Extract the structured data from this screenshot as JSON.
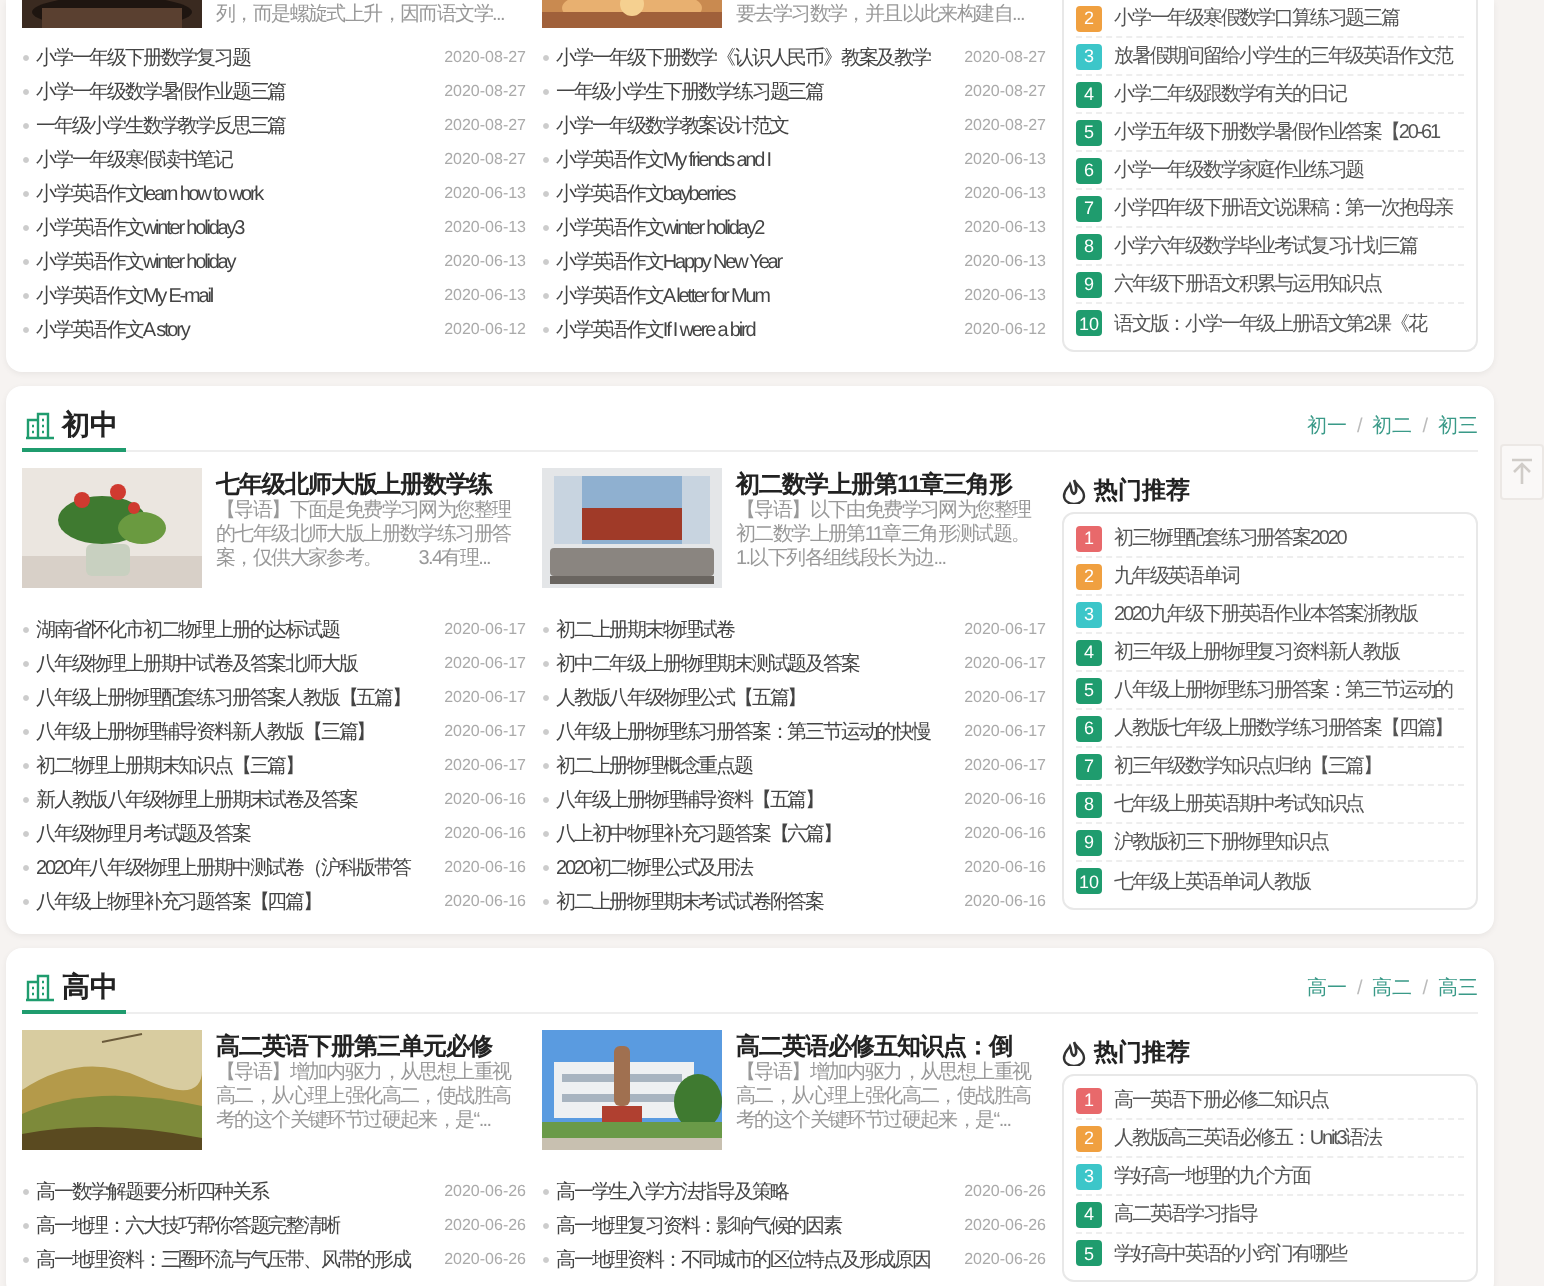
{
  "sections": [
    {
      "kind": "cut_top",
      "features": [
        {
          "snippet": "列，而是螺旋式上升，因而语文学..."
        },
        {
          "snippet": "要去学习数学，并且以此来构建自..."
        }
      ],
      "columns": [
        {
          "items": [
            {
              "title": "小学一年级下册数学复习题",
              "date": "2020-08-27"
            },
            {
              "title": "小学一年级数学暑假作业题三篇",
              "date": "2020-08-27"
            },
            {
              "title": "一年级小学生数学教学反思三篇",
              "date": "2020-08-27"
            },
            {
              "title": "小学一年级寒假读书笔记",
              "date": "2020-08-27"
            },
            {
              "title": "小学英语作文learn how to work",
              "date": "2020-06-13"
            },
            {
              "title": "小学英语作文winter holiday3",
              "date": "2020-06-13"
            },
            {
              "title": "小学英语作文winter holiday",
              "date": "2020-06-13"
            },
            {
              "title": "小学英语作文My E-mail",
              "date": "2020-06-13"
            },
            {
              "title": "小学英语作文A story",
              "date": "2020-06-12"
            }
          ]
        },
        {
          "items": [
            {
              "title": "小学一年级下册数学《认识人民币》教案及教学",
              "date": "2020-08-27"
            },
            {
              "title": "一年级小学生下册数学练习题三篇",
              "date": "2020-08-27"
            },
            {
              "title": "小学一年级数学教案设计范文",
              "date": "2020-08-27"
            },
            {
              "title": "小学英语作文My friends and I",
              "date": "2020-06-13"
            },
            {
              "title": "小学英语作文bayberries",
              "date": "2020-06-13"
            },
            {
              "title": "小学英语作文winter holiday2",
              "date": "2020-06-13"
            },
            {
              "title": "小学英语作文Happy New Year",
              "date": "2020-06-13"
            },
            {
              "title": "小学英语作文A letter for Mum",
              "date": "2020-06-13"
            },
            {
              "title": "小学英语作文If I were a bird",
              "date": "2020-06-12"
            }
          ]
        }
      ],
      "hot": {
        "items": [
          {
            "rank": "2",
            "title": "小学一年级寒假数学口算练习题三篇",
            "color": "#f0a040"
          },
          {
            "rank": "3",
            "title": "放暑假期间留给小学生的三年级英语作文范",
            "color": "#3cc6c9"
          },
          {
            "rank": "4",
            "title": "小学二年级跟数学有关的日记",
            "color": "#1f9c6e"
          },
          {
            "rank": "5",
            "title": "小学五年级下册数学暑假作业答案【20-61",
            "color": "#1f9c6e"
          },
          {
            "rank": "6",
            "title": "小学一年级数学家庭作业练习题",
            "color": "#1f9c6e"
          },
          {
            "rank": "7",
            "title": "小学四年级下册语文说课稿：第一次抱母亲",
            "color": "#1f9c6e"
          },
          {
            "rank": "8",
            "title": "小学六年级数学毕业考试复习计划三篇",
            "color": "#1f9c6e"
          },
          {
            "rank": "9",
            "title": "六年级下册语文积累与运用知识点",
            "color": "#1f9c6e"
          },
          {
            "rank": "10",
            "title": "语文版：小学一年级上册语文第2课《花",
            "color": "#1f9c6e"
          }
        ]
      }
    },
    {
      "kind": "full",
      "title": "初中",
      "links": [
        "初一",
        "初二",
        "初三"
      ],
      "separators": [
        "/",
        "/"
      ],
      "features": [
        {
          "title": "七年级北师大版上册数学练",
          "snippet": "【导语】下面是免费学习网为您整理的七年级北师大版上册数学练习册答案，仅供大家参考。　　3.4有理..."
        },
        {
          "title": "初二数学上册第11章三角形",
          "snippet": "【导语】以下由免费学习网为您整理初二数学上册第11章三角形测试题。　　1.以下列各组线段长为边..."
        }
      ],
      "columns": [
        {
          "items": [
            {
              "title": "湖南省怀化市初二物理上册的达标试题",
              "date": "2020-06-17"
            },
            {
              "title": "八年级物理上册期中试卷及答案北师大版",
              "date": "2020-06-17"
            },
            {
              "title": "八年级上册物理配套练习册答案人教版【五篇】",
              "date": "2020-06-17"
            },
            {
              "title": "八年级上册物理辅导资料新人教版【三篇】",
              "date": "2020-06-17"
            },
            {
              "title": "初二物理上册期末知识点【三篇】",
              "date": "2020-06-17"
            },
            {
              "title": "新人教版八年级物理上册期末试卷及答案",
              "date": "2020-06-16"
            },
            {
              "title": "八年级物理月考试题及答案",
              "date": "2020-06-16"
            },
            {
              "title": "2020年八年级物理上册期中测试卷（沪科版带答",
              "date": "2020-06-16"
            },
            {
              "title": "八年级上物理补充习题答案【四篇】",
              "date": "2020-06-16"
            }
          ]
        },
        {
          "items": [
            {
              "title": "初二上册期末物理试卷",
              "date": "2020-06-17"
            },
            {
              "title": "初中二年级上册物理期末测试题及答案",
              "date": "2020-06-17"
            },
            {
              "title": "人教版八年级物理公式【五篇】",
              "date": "2020-06-17"
            },
            {
              "title": "八年级上册物理练习册答案：第三节运动的快慢",
              "date": "2020-06-17"
            },
            {
              "title": "初二上册物理概念重点题",
              "date": "2020-06-17"
            },
            {
              "title": "八年级上册物理辅导资料【五篇】",
              "date": "2020-06-16"
            },
            {
              "title": "八上初中物理补充习题答案【六篇】",
              "date": "2020-06-16"
            },
            {
              "title": "2020初二物理公式及用法",
              "date": "2020-06-16"
            },
            {
              "title": "初二上册物理期末考试试卷附答案",
              "date": "2020-06-16"
            }
          ]
        }
      ],
      "hot": {
        "title": "热门推荐",
        "items": [
          {
            "rank": "1",
            "title": "初三物理配套练习册答案2020",
            "color": "#e8696b"
          },
          {
            "rank": "2",
            "title": "九年级英语单词",
            "color": "#f0a040"
          },
          {
            "rank": "3",
            "title": "2020九年级下册英语作业本答案浙教版",
            "color": "#3cc6c9"
          },
          {
            "rank": "4",
            "title": "初三年级上册物理复习资料新人教版",
            "color": "#1f9c6e"
          },
          {
            "rank": "5",
            "title": "八年级上册物理练习册答案：第三节运动的",
            "color": "#1f9c6e"
          },
          {
            "rank": "6",
            "title": "人教版七年级上册数学练习册答案【四篇】",
            "color": "#1f9c6e"
          },
          {
            "rank": "7",
            "title": "初三年级数学知识点归纳【三篇】",
            "color": "#1f9c6e"
          },
          {
            "rank": "8",
            "title": "七年级上册英语期中考试知识点",
            "color": "#1f9c6e"
          },
          {
            "rank": "9",
            "title": "沪教版初三下册物理知识点",
            "color": "#1f9c6e"
          },
          {
            "rank": "10",
            "title": "七年级上英语单词人教版",
            "color": "#1f9c6e"
          }
        ]
      }
    },
    {
      "kind": "full",
      "title": "高中",
      "links": [
        "高一",
        "高二",
        "高三"
      ],
      "separators": [
        "/",
        "/"
      ],
      "features": [
        {
          "title": "高二英语下册第三单元必修",
          "snippet": "【导语】增加内驱力，从思想上重视高二，从心理上强化高二，使战胜高考的这个关键环节过硬起来，是“..."
        },
        {
          "title": "高二英语必修五知识点：倒",
          "snippet": "【导语】增加内驱力，从思想上重视高二，从心理上强化高二，使战胜高考的这个关键环节过硬起来，是“..."
        }
      ],
      "columns": [
        {
          "items": [
            {
              "title": "高一数学解题要分析四种关系",
              "date": "2020-06-26"
            },
            {
              "title": "高一地理：六大技巧帮你答题完整清晰",
              "date": "2020-06-26"
            },
            {
              "title": "高一地理资料：三圈环流与气压带、风带的形成",
              "date": "2020-06-26"
            }
          ]
        },
        {
          "items": [
            {
              "title": "高一学生入学方法指导及策略",
              "date": "2020-06-26"
            },
            {
              "title": "高一地理复习资料：影响气候的因素",
              "date": "2020-06-26"
            },
            {
              "title": "高一地理资料：不同城市的区位特点及形成原因",
              "date": "2020-06-26"
            }
          ]
        }
      ],
      "hot": {
        "title": "热门推荐",
        "items": [
          {
            "rank": "1",
            "title": "高一英语下册必修二知识点",
            "color": "#e8696b"
          },
          {
            "rank": "2",
            "title": "人教版高三英语必修五：Unit3语法",
            "color": "#f0a040"
          },
          {
            "rank": "3",
            "title": "学好高一地理的九个方面",
            "color": "#3cc6c9"
          },
          {
            "rank": "4",
            "title": "高二英语学习指导",
            "color": "#1f9c6e"
          },
          {
            "rank": "5",
            "title": "学好高中英语的小窍门有哪些",
            "color": "#1f9c6e"
          }
        ]
      }
    }
  ]
}
